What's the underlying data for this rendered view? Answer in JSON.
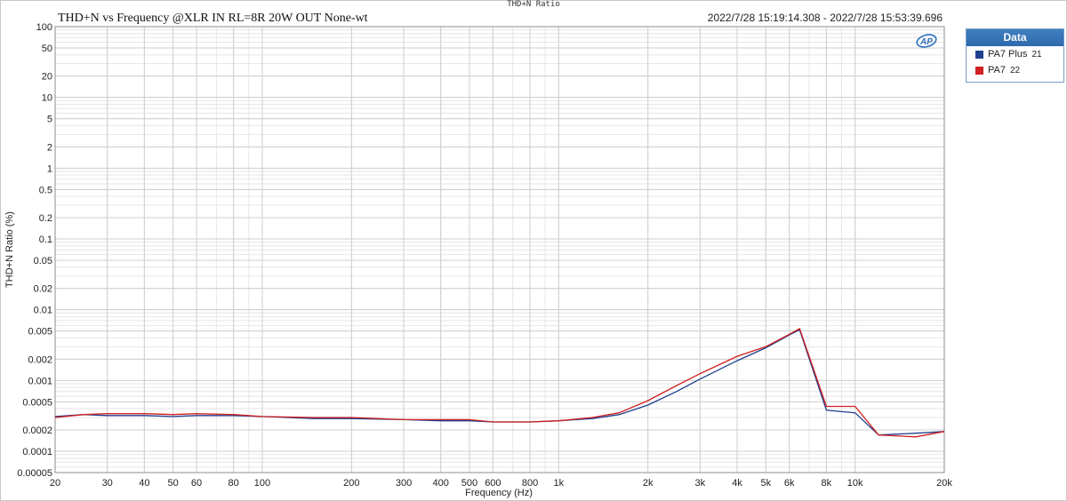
{
  "window": {
    "title": "THD+N Ratio"
  },
  "header": {
    "chart_title": "THD+N vs Frequency @XLR IN  RL=8R 20W OUT  None-wt",
    "timestamp": "2022/7/28 15:19:14.308 - 2022/7/28 15:53:39.696"
  },
  "legend": {
    "title": "Data",
    "items": [
      {
        "label": "PA7 Plus",
        "index": "21",
        "color": "#1f3f8f"
      },
      {
        "label": "PA7",
        "index": "22",
        "color": "#d02020"
      }
    ]
  },
  "chart_data": {
    "type": "line",
    "title": "THD+N vs Frequency @XLR IN  RL=8R 20W OUT  None-wt",
    "xlabel": "Frequency (Hz)",
    "ylabel": "THD+N Ratio (%)",
    "x_scale": "log",
    "y_scale": "log",
    "xlim": [
      20,
      20000
    ],
    "ylim": [
      5e-05,
      100
    ],
    "grid": true,
    "legend_position": "right",
    "x_ticks": [
      20,
      30,
      40,
      50,
      60,
      80,
      100,
      200,
      300,
      400,
      500,
      600,
      800,
      1000,
      2000,
      3000,
      4000,
      5000,
      6000,
      8000,
      10000,
      20000
    ],
    "x_tick_labels": [
      "20",
      "30",
      "40",
      "50",
      "60",
      "80",
      "100",
      "200",
      "300",
      "400",
      "500",
      "600",
      "800",
      "1k",
      "2k",
      "3k",
      "4k",
      "5k",
      "6k",
      "8k",
      "10k",
      "20k"
    ],
    "y_ticks": [
      100,
      50,
      20,
      10,
      5,
      2,
      1,
      0.5,
      0.2,
      0.1,
      0.05,
      0.02,
      0.01,
      0.005,
      0.002,
      0.001,
      0.0005,
      0.0002,
      0.0001,
      5e-05
    ],
    "y_tick_labels": [
      "100",
      "50",
      "20",
      "10",
      "5",
      "2",
      "1",
      "0.5",
      "0.2",
      "0.1",
      "0.05",
      "0.02",
      "0.01",
      "0.005",
      "0.002",
      "0.001",
      "0.0005",
      "0.0002",
      "0.0001",
      "0.00005"
    ],
    "series": [
      {
        "name": "PA7 Plus 21",
        "color": "#1f3f8f",
        "x": [
          20,
          25,
          30,
          40,
          50,
          60,
          80,
          100,
          150,
          200,
          300,
          400,
          500,
          600,
          800,
          1000,
          1300,
          1600,
          2000,
          2500,
          3000,
          4000,
          5000,
          6000,
          6500,
          8000,
          10000,
          12000,
          16000,
          20000
        ],
        "y": [
          0.00031,
          0.00033,
          0.00032,
          0.00032,
          0.00031,
          0.00032,
          0.00032,
          0.00031,
          0.00029,
          0.00029,
          0.00028,
          0.00027,
          0.00027,
          0.00026,
          0.00026,
          0.00027,
          0.00029,
          0.00033,
          0.00045,
          0.0007,
          0.00105,
          0.0019,
          0.0029,
          0.0044,
          0.0052,
          0.00038,
          0.00035,
          0.00017,
          0.00018,
          0.00019
        ]
      },
      {
        "name": "PA7 22",
        "color": "#d02020",
        "x": [
          20,
          25,
          30,
          40,
          50,
          60,
          80,
          100,
          150,
          200,
          300,
          400,
          500,
          600,
          800,
          1000,
          1300,
          1600,
          2000,
          2500,
          3000,
          4000,
          5000,
          6000,
          6500,
          8000,
          10000,
          12000,
          16000,
          20000
        ],
        "y": [
          0.0003,
          0.00033,
          0.00034,
          0.00034,
          0.00033,
          0.00034,
          0.00033,
          0.00031,
          0.0003,
          0.0003,
          0.00028,
          0.00028,
          0.00028,
          0.00026,
          0.00026,
          0.00027,
          0.0003,
          0.00035,
          0.00052,
          0.00085,
          0.00125,
          0.0022,
          0.003,
          0.0045,
          0.0054,
          0.00043,
          0.00043,
          0.00017,
          0.00016,
          0.00019
        ]
      }
    ]
  }
}
